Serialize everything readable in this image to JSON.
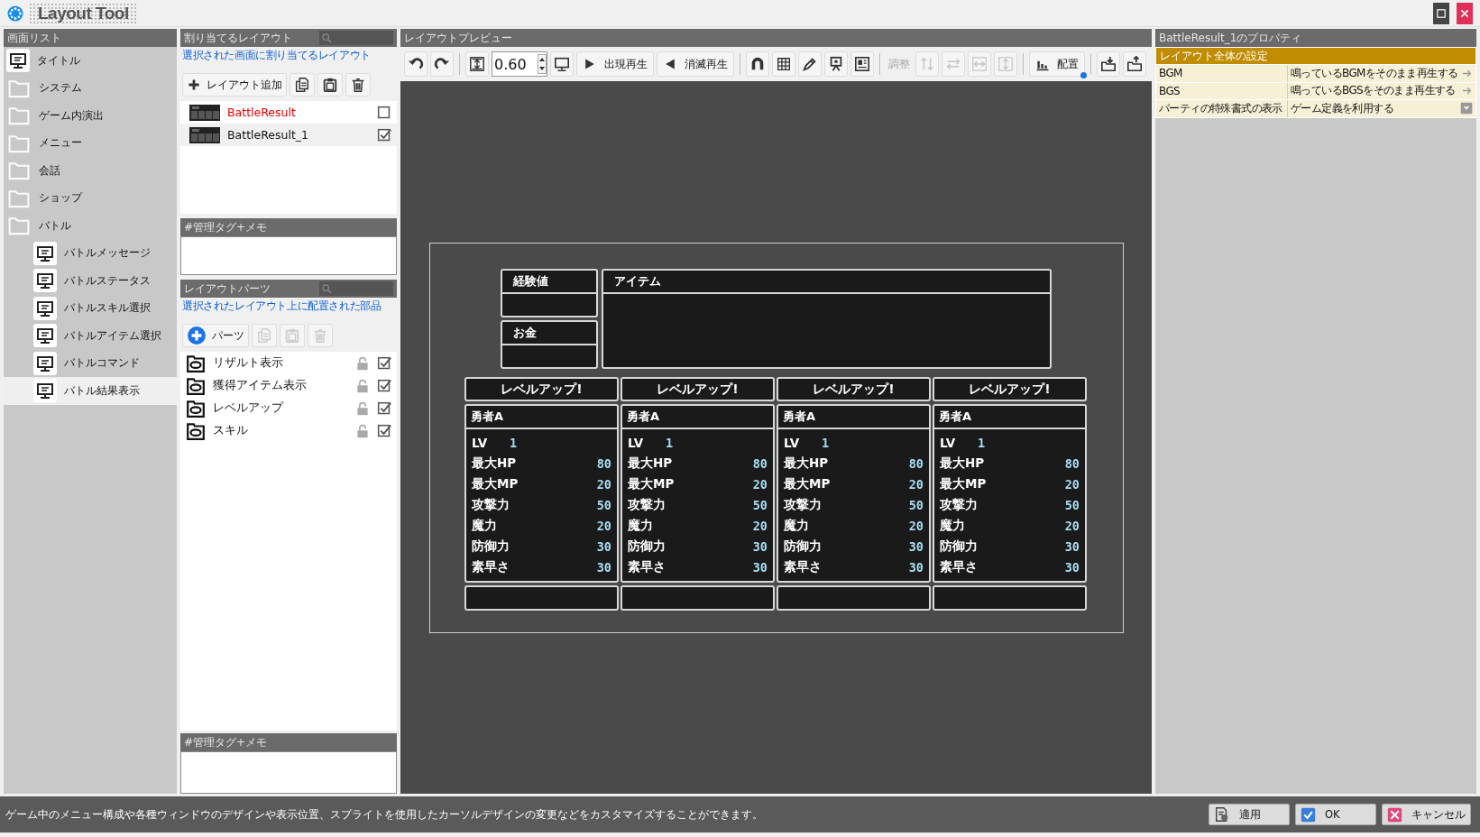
{
  "window": {
    "title": "Layout Tool"
  },
  "screen_list": {
    "title": "画面リスト",
    "items": [
      {
        "label": "タイトル",
        "kind": "screen",
        "selected": false
      },
      {
        "label": "システム",
        "kind": "folder",
        "selected": false
      },
      {
        "label": "ゲーム内演出",
        "kind": "folder",
        "selected": false
      },
      {
        "label": "メニュー",
        "kind": "folder",
        "selected": false
      },
      {
        "label": "会話",
        "kind": "folder",
        "selected": false
      },
      {
        "label": "ショップ",
        "kind": "folder",
        "selected": false
      },
      {
        "label": "バトル",
        "kind": "folder",
        "selected": false,
        "children": [
          {
            "label": "バトルメッセージ",
            "kind": "screen",
            "selected": false
          },
          {
            "label": "バトルステータス",
            "kind": "screen",
            "selected": false
          },
          {
            "label": "バトルスキル選択",
            "kind": "screen",
            "selected": false
          },
          {
            "label": "バトルアイテム選択",
            "kind": "screen",
            "selected": false
          },
          {
            "label": "バトルコマンド",
            "kind": "screen",
            "selected": false
          },
          {
            "label": "バトル結果表示",
            "kind": "screen",
            "selected": true
          }
        ]
      }
    ]
  },
  "layouts": {
    "title": "割り当てるレイアウト",
    "description": "選択された画面に割り当てるレイアウト",
    "add_button": "レイアウト追加",
    "items": [
      {
        "name": "BattleResult",
        "highlighted": true,
        "selected": false,
        "checked": false
      },
      {
        "name": "BattleResult_1",
        "highlighted": false,
        "selected": true,
        "checked": true
      }
    ],
    "memo_title": "#管理タグ+メモ"
  },
  "parts": {
    "title": "レイアウトパーツ",
    "description": "選択されたレイアウト上に配置された部品",
    "add_button": "パーツ",
    "items": [
      {
        "name": "リザルト表示",
        "locked": false,
        "checked": true
      },
      {
        "name": "獲得アイテム表示",
        "locked": false,
        "checked": true
      },
      {
        "name": "レベルアップ",
        "locked": false,
        "checked": true
      },
      {
        "name": "スキル",
        "locked": false,
        "checked": true
      }
    ],
    "memo_title": "#管理タグ+メモ"
  },
  "preview": {
    "title": "レイアウトプレビュー",
    "toolbar": [
      {
        "kind": "icon",
        "disabled": false
      },
      {
        "kind": "icon",
        "disabled": false
      },
      {
        "kind": "separator"
      },
      {
        "kind": "icon",
        "disabled": false
      },
      {
        "kind": "zoom",
        "value": "0.60"
      },
      {
        "kind": "icon",
        "disabled": false
      },
      {
        "kind": "button",
        "label": "出現再生"
      },
      {
        "kind": "button",
        "label": "消滅再生"
      },
      {
        "kind": "separator"
      },
      {
        "kind": "icon",
        "disabled": false
      },
      {
        "kind": "icon",
        "disabled": false
      },
      {
        "kind": "icon",
        "disabled": false
      },
      {
        "kind": "icon",
        "disabled": false
      },
      {
        "kind": "icon",
        "disabled": false
      },
      {
        "kind": "separator"
      },
      {
        "kind": "label",
        "label": "調整",
        "disabled": true
      },
      {
        "kind": "icon",
        "disabled": true
      },
      {
        "kind": "icon",
        "disabled": true
      },
      {
        "kind": "icon",
        "disabled": true
      },
      {
        "kind": "icon",
        "disabled": true
      },
      {
        "kind": "separator"
      },
      {
        "kind": "button",
        "label": "配置",
        "indicator": true
      },
      {
        "kind": "separator"
      },
      {
        "kind": "icon",
        "disabled": false
      },
      {
        "kind": "icon",
        "disabled": false
      }
    ],
    "canvas": {
      "exp_label": "経験値",
      "money_label": "お金",
      "item_label": "アイテム",
      "characters": [
        {
          "banner": "レベルアップ!",
          "name": "勇者A",
          "stats": [
            {
              "kind": "level",
              "label": "LV",
              "value": "1"
            },
            {
              "kind": "stat",
              "label": "最大HP",
              "value": "80"
            },
            {
              "kind": "stat",
              "label": "最大MP",
              "value": "20"
            },
            {
              "kind": "stat",
              "label": "攻撃力",
              "value": "50"
            },
            {
              "kind": "stat",
              "label": "魔力",
              "value": "20"
            },
            {
              "kind": "stat",
              "label": "防御力",
              "value": "30"
            },
            {
              "kind": "stat",
              "label": "素早さ",
              "value": "30"
            }
          ]
        },
        {
          "banner": "レベルアップ!",
          "name": "勇者A",
          "stats": [
            {
              "kind": "level",
              "label": "LV",
              "value": "1"
            },
            {
              "kind": "stat",
              "label": "最大HP",
              "value": "80"
            },
            {
              "kind": "stat",
              "label": "最大MP",
              "value": "20"
            },
            {
              "kind": "stat",
              "label": "攻撃力",
              "value": "50"
            },
            {
              "kind": "stat",
              "label": "魔力",
              "value": "20"
            },
            {
              "kind": "stat",
              "label": "防御力",
              "value": "30"
            },
            {
              "kind": "stat",
              "label": "素早さ",
              "value": "30"
            }
          ]
        },
        {
          "banner": "レベルアップ!",
          "name": "勇者A",
          "stats": [
            {
              "kind": "level",
              "label": "LV",
              "value": "1"
            },
            {
              "kind": "stat",
              "label": "最大HP",
              "value": "80"
            },
            {
              "kind": "stat",
              "label": "最大MP",
              "value": "20"
            },
            {
              "kind": "stat",
              "label": "攻撃力",
              "value": "50"
            },
            {
              "kind": "stat",
              "label": "魔力",
              "value": "20"
            },
            {
              "kind": "stat",
              "label": "防御力",
              "value": "30"
            },
            {
              "kind": "stat",
              "label": "素早さ",
              "value": "30"
            }
          ]
        },
        {
          "banner": "レベルアップ!",
          "name": "勇者A",
          "stats": [
            {
              "kind": "level",
              "label": "LV",
              "value": "1"
            },
            {
              "kind": "stat",
              "label": "最大HP",
              "value": "80"
            },
            {
              "kind": "stat",
              "label": "最大MP",
              "value": "20"
            },
            {
              "kind": "stat",
              "label": "攻撃力",
              "value": "50"
            },
            {
              "kind": "stat",
              "label": "魔力",
              "value": "20"
            },
            {
              "kind": "stat",
              "label": "防御力",
              "value": "30"
            },
            {
              "kind": "stat",
              "label": "素早さ",
              "value": "30"
            }
          ]
        }
      ]
    }
  },
  "properties": {
    "title": "BattleResult_1のプロパティ",
    "section": "レイアウト全体の設定",
    "rows": [
      {
        "label": "BGM",
        "value": "鳴っているBGMをそのまま再生する",
        "kind": "arrow"
      },
      {
        "label": "BGS",
        "value": "鳴っているBGSをそのまま再生する",
        "kind": "arrow"
      },
      {
        "label": "パーティの特殊書式の表示",
        "value": "ゲーム定義を利用する",
        "kind": "dropdown"
      }
    ]
  },
  "status_bar": {
    "message": "ゲーム中のメニュー構成や各種ウィンドウのデザインや表示位置、スプライトを使用したカーソルデザインの変更などをカスタマイズすることができます。",
    "buttons": [
      {
        "label": "適用",
        "kind": "apply"
      },
      {
        "label": "OK",
        "kind": "ok"
      },
      {
        "label": "キャンセル",
        "kind": "cancel"
      }
    ]
  }
}
